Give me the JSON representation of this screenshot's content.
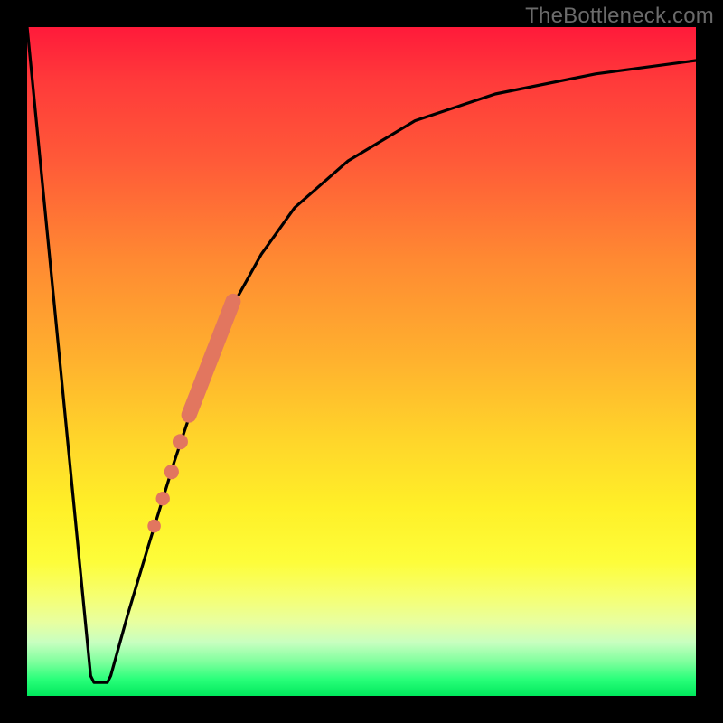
{
  "watermark": "TheBottleneck.com",
  "colors": {
    "frame": "#000000",
    "curve": "#000000",
    "marker": "#e2765f",
    "gradient_stops": [
      "#ff1a3a",
      "#ff3a3a",
      "#ff5a38",
      "#ff8a32",
      "#ffb22e",
      "#ffd62a",
      "#fff028",
      "#fdfd3a",
      "#f6ff70",
      "#e8ffa0",
      "#c8ffc0",
      "#7cff9c",
      "#2aff7a",
      "#00e85c"
    ]
  },
  "chart_data": {
    "type": "line",
    "title": "",
    "xlabel": "",
    "ylabel": "",
    "xlim": [
      0,
      100
    ],
    "ylim": [
      0,
      100
    ],
    "curve": [
      {
        "x": 0,
        "y": 100
      },
      {
        "x": 9.5,
        "y": 3
      },
      {
        "x": 10,
        "y": 2
      },
      {
        "x": 12,
        "y": 2
      },
      {
        "x": 12.5,
        "y": 3
      },
      {
        "x": 15,
        "y": 12
      },
      {
        "x": 18,
        "y": 22
      },
      {
        "x": 22,
        "y": 35
      },
      {
        "x": 26,
        "y": 47
      },
      {
        "x": 30,
        "y": 57
      },
      {
        "x": 35,
        "y": 66
      },
      {
        "x": 40,
        "y": 73
      },
      {
        "x": 48,
        "y": 80
      },
      {
        "x": 58,
        "y": 86
      },
      {
        "x": 70,
        "y": 90
      },
      {
        "x": 85,
        "y": 93
      },
      {
        "x": 100,
        "y": 95
      }
    ],
    "marker_segment": {
      "start": {
        "x": 24.2,
        "y": 42
      },
      "end": {
        "x": 30.8,
        "y": 59
      }
    },
    "marker_dots": [
      {
        "x": 22.9,
        "y": 38
      },
      {
        "x": 21.6,
        "y": 33.5
      },
      {
        "x": 20.3,
        "y": 29.5
      },
      {
        "x": 19.0,
        "y": 25.4
      }
    ]
  }
}
